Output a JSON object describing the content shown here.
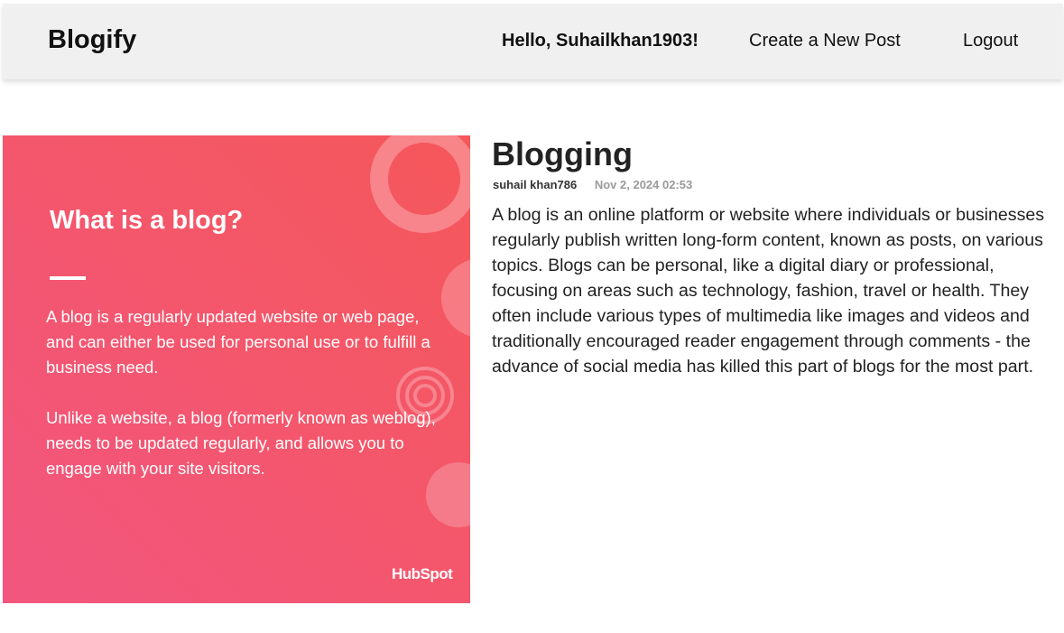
{
  "header": {
    "brand": "Blogify",
    "greeting": "Hello, Suhailkhan1903!",
    "create_post": "Create a New Post",
    "logout": "Logout"
  },
  "post": {
    "title": "Blogging",
    "author": "suhail khan786",
    "date": "Nov 2, 2024 02:53",
    "body": "A blog is an online platform or website where individuals or businesses regularly publish written long-form content, known as posts, on various topics. Blogs can be personal, like a digital diary or professional, focusing on areas such as technology, fashion, travel or health. They often include various types of multimedia like images and videos and traditionally encouraged reader engagement through comments - the advance of social media has killed this part of blogs for the most part.",
    "image": {
      "heading": "What is a blog?",
      "paragraph_1": "A blog is a regularly updated website or web page, and can either be used for personal use or to fulfill a business need.",
      "paragraph_2": "Unlike a website, a blog (formerly known as weblog), needs to be updated regularly, and allows you to engage with your site visitors.",
      "logo": "HubSpot",
      "colors": {
        "gradient_start": "#f5575a",
        "gradient_end": "#f2567f"
      }
    }
  }
}
